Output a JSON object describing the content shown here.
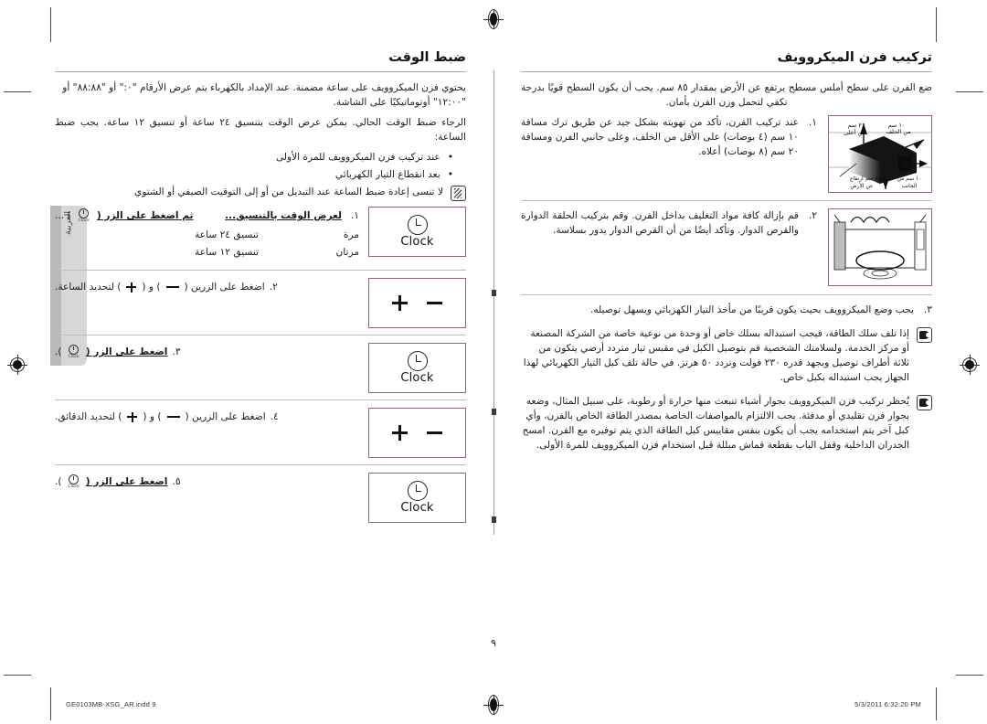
{
  "document": {
    "language_tab": "العربية",
    "page_number": "٩",
    "footer_file": "GE0103MB-XSG_AR.indd   9",
    "footer_timestamp": "5/3/2011   6:32:20 PM",
    "accent_rule_color": "#a8a8a8",
    "figure_border_color": "#8e6b6b"
  },
  "right_column": {
    "title": "تركيب فرن الميكروويف",
    "intro": "ضع الفرن على سطح أملس مسطح يرتفع عن الأرض بمقدار ٨٥ سم. يجب أن يكون السطح قويًا بدرجة تكفي لتحمل وزن الفرن بأمان.",
    "steps": [
      {
        "num": "١.",
        "lines": [
          "عند تركيب الفرن، تأكد من تهويته بشكل جيد عن طريق ترك مسافة",
          "١٠ سم (٤ بوصات) على الأقل من الخلف، وعلى جانبي الفرن ومسافة",
          "٢٠ سم (٨ بوصات) أعلاه."
        ],
        "figure": "oven-clearance-diagram",
        "figure_labels": [
          "١٠ سم",
          "٢٠ سم",
          "١٠ سم",
          "٨٥ سم",
          "من الخلف",
          "من أعلى",
          "من الجانب",
          "ارتفاع عن الأرض"
        ]
      },
      {
        "num": "٢.",
        "lines": [
          "قم بإزالة كافة مواد التغليف بداخل الفرن.",
          "وقم بتركيب الحلقة الدوارة والقرص الدوار.",
          "وتأكد أيضًا من أن القرص الدوار يدور بسلاسة."
        ],
        "figure": "oven-interior-turntable-diagram",
        "figure_labels": []
      },
      {
        "num": "٣.",
        "lines": [
          "يجب وضع الميكروويف بحيث يكون قريبًا من مأخذ التيار الكهربائي ويسهل توصيله."
        ],
        "figure": null,
        "figure_labels": []
      }
    ],
    "notes": [
      {
        "icon": "hand-pointer-icon",
        "lines": [
          "إذا تلف سلك الطاقة، فيجب استبداله بسلك خاص أو وحدة من نوعية خاصة من الشركة المصنعة",
          "أو مركز الخدمة.",
          "ولسلامتك الشخصية قم بتوصيل الكبل في مقبس تيار متردد أرضي يتكون من ثلاثة أطراف",
          "توصيل وبجهد قدره ٢٣٠ فولت وتردد ٥٠ هرتز. في حالة تلف كبل التيار الكهربائي لهذا الجهاز يجب",
          "استبداله بكبل خاص."
        ]
      },
      {
        "icon": "hand-pointer-icon",
        "lines": [
          "يُحظر تركيب فرن الميكروويف بجوار أشياء تنبعث منها حرارة أو رطوبة، على سبيل المثال، وضعه",
          "بجوار فرن تقليدي أو مدفئة. يجب الالتزام بالمواصفات الخاصة بمصدر الطاقة الخاص بالفرن، وأي كبل",
          "آخر يتم استخدامه يجب أن يكون بنفس مقاييس كبل الطاقة الذي يتم توفيره مع الفرن. امسح",
          "الجدران الداخلية وقفل الباب بقطعة قماش مبللة قبل استخدام فرن الميكروويف للمرة الأولى."
        ]
      }
    ]
  },
  "left_column": {
    "title": "ضبط الوقت",
    "intro_lines": [
      "يحتوي فرن الميكروويف على ساعة مضمنة. عند الإمداد بالكهرباء يتم عرض الأرقام \"٠:\" أو \"٨٨:٨٨\" أو",
      "\"١٢:٠٠\" أوتوماتيكيًا على الشاشة.",
      "الرجاء ضبط الوقت الحالي. يمكن عرض الوقت بتنسيق ٢٤ ساعة أو تنسيق ١٢ ساعة. يجب ضبط الساعة:"
    ],
    "bullets": [
      "عند تركيب فرن الميكروويف للمرة الأولى",
      "بعد انقطاع التيار الكهربائي"
    ],
    "note": {
      "icon": "pencil-note-icon",
      "text": "لا تنسى إعادة ضبط الساعة عند التبديل من أو إلى التوقيت الصيفي أو الشتوي"
    },
    "steps": [
      {
        "num": "١.",
        "text_left": "لعرض الوقت بالتنسيق...",
        "text_right": "ثم اضغط على الزر (",
        "text_tail": " ) ...",
        "button": "clock-button",
        "button_label": "Clock",
        "format_table": [
          {
            "format": "تنسيق ٢٤ ساعة",
            "presses": "مرة"
          },
          {
            "format": "تنسيق ١٢ ساعة",
            "presses": "مرتان"
          }
        ]
      },
      {
        "num": "٢.",
        "text": "اضغط على الزرين (",
        "text_mid": ") و (",
        "text_tail": ") لتحديد الساعة.",
        "button": "minus-plus-button"
      },
      {
        "num": "٣.",
        "text": "اضغط على الزر (",
        "text_tail": ").",
        "button": "clock-button",
        "button_label": "Clock"
      },
      {
        "num": "٤.",
        "text": "اضغط على الزرين (",
        "text_mid": ") و (",
        "text_tail": ") لتحديد الدقائق.",
        "button": "minus-plus-button"
      },
      {
        "num": "٥.",
        "text": "اضغط على الزر (",
        "text_tail": ").",
        "button": "clock-button",
        "button_label": "Clock"
      }
    ]
  }
}
